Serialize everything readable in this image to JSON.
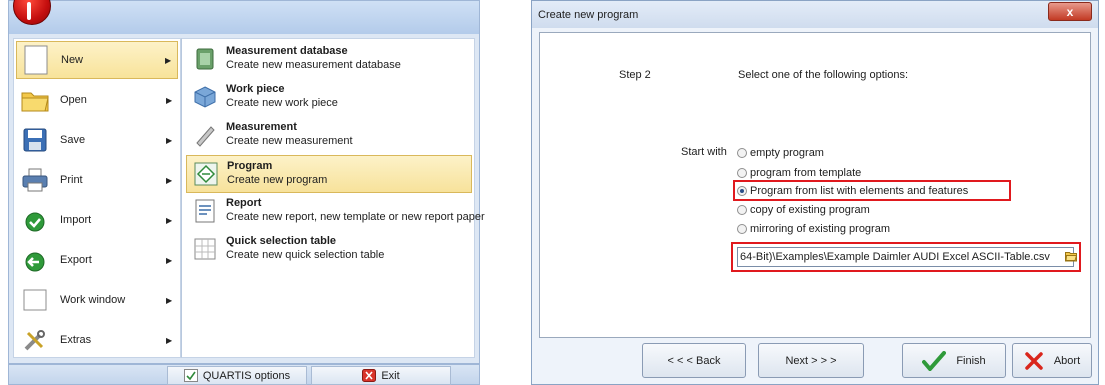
{
  "menu": {
    "commands": [
      {
        "label": "New",
        "icon": "blank-document-icon",
        "active": true,
        "arrow": "▶"
      },
      {
        "label": "Open",
        "icon": "folder-icon",
        "arrow": "▶"
      },
      {
        "label": "Save",
        "icon": "floppy-disk-icon",
        "arrow": "▶"
      },
      {
        "label": "Print",
        "icon": "printer-icon",
        "arrow": "▶"
      },
      {
        "label": "Import",
        "icon": "import-arrow-icon",
        "arrow": "▶"
      },
      {
        "label": "Export",
        "icon": "export-arrow-icon",
        "arrow": "▶"
      },
      {
        "label": "Work window",
        "icon": "window-icon",
        "arrow": "▶"
      },
      {
        "label": "Extras",
        "icon": "tools-icon",
        "arrow": "▶"
      }
    ],
    "submenu": [
      {
        "title": "Measurement database",
        "desc": "Create new measurement database",
        "icon": "database-icon"
      },
      {
        "title": "Work piece",
        "desc": "Create new work piece",
        "icon": "cube-icon"
      },
      {
        "title": "Measurement",
        "desc": "Create new measurement",
        "icon": "caliper-icon"
      },
      {
        "title": "Program",
        "desc": "Create new program",
        "icon": "program-icon",
        "active": true
      },
      {
        "title": "Report",
        "desc": "Create new report, new template or new report paper",
        "icon": "report-icon"
      },
      {
        "title": "Quick selection table",
        "desc": "Create new quick selection table",
        "icon": "table-icon"
      }
    ],
    "footer": {
      "options_label": "QUARTIS options",
      "exit_label": "Exit"
    }
  },
  "dialog": {
    "title": "Create new program",
    "close_glyph": "x",
    "step_label": "Step 2",
    "instruction": "Select one of the following options:",
    "start_with_label": "Start with",
    "options": [
      {
        "label": "empty program",
        "selected": false
      },
      {
        "label": "program from template",
        "selected": false
      },
      {
        "label": "Program from list with elements and features",
        "selected": true
      },
      {
        "label": "copy of existing program",
        "selected": false
      },
      {
        "label": "mirroring of existing program",
        "selected": false
      }
    ],
    "file_path": "64-Bit)\\Examples\\Example Daimler AUDI Excel ASCII-Table.csv",
    "buttons": {
      "back": "< < < Back",
      "next": "Next > > >",
      "finish": "Finish",
      "abort": "Abort"
    }
  },
  "colors": {
    "highlight": "#e0191e",
    "menu_active": "#f8e39a",
    "accent": "#2a4f8a"
  }
}
